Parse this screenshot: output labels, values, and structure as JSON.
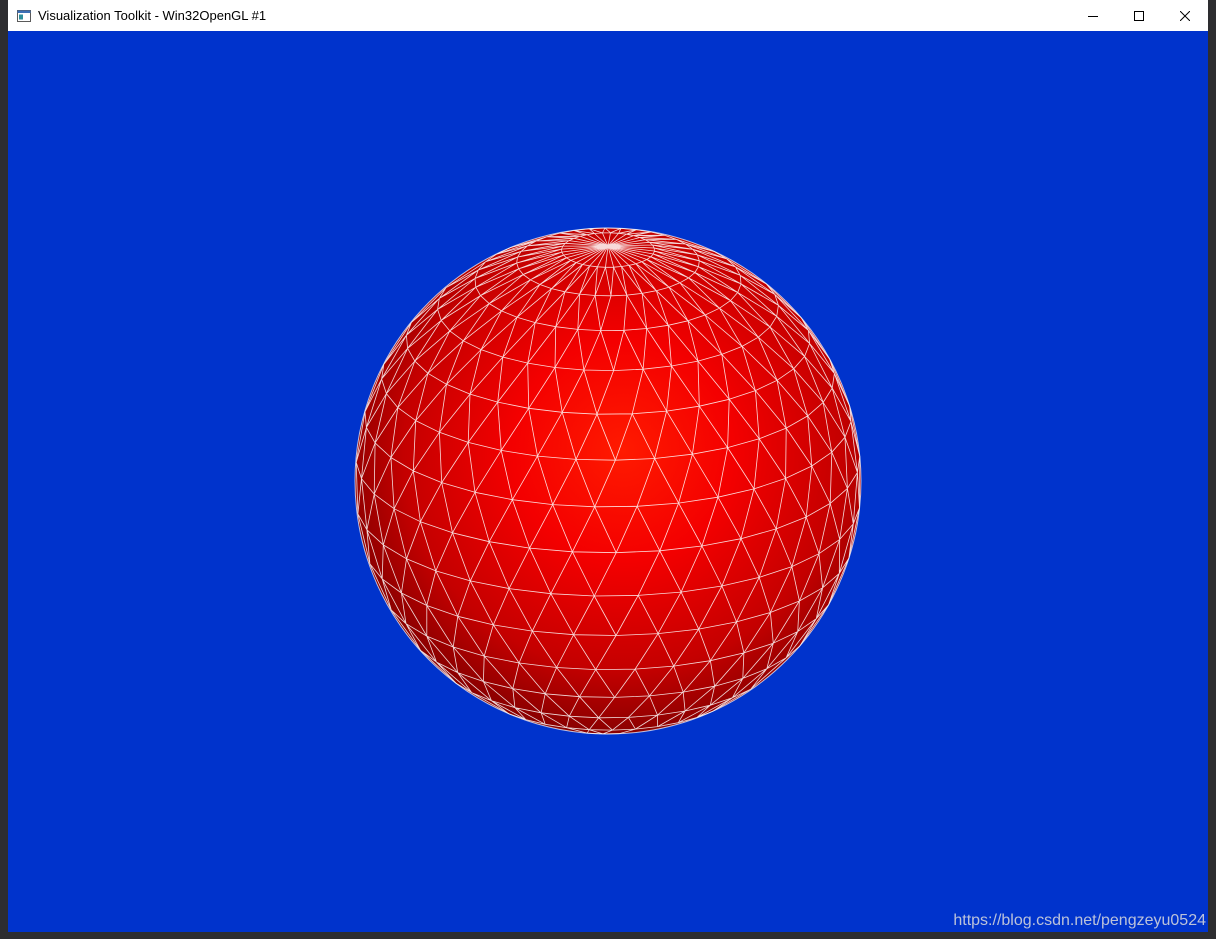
{
  "window": {
    "title": "Visualization Toolkit - Win32OpenGL #1",
    "minimize_icon": "minimize-icon",
    "maximize_icon": "maximize-icon",
    "close_icon": "close-icon"
  },
  "scene": {
    "background_color": "#0033cc",
    "sphere_color": "#ff0000",
    "edge_color": "#ffffff",
    "object": "sphere"
  },
  "watermark": "https://blog.csdn.net/pengzeyu0524"
}
